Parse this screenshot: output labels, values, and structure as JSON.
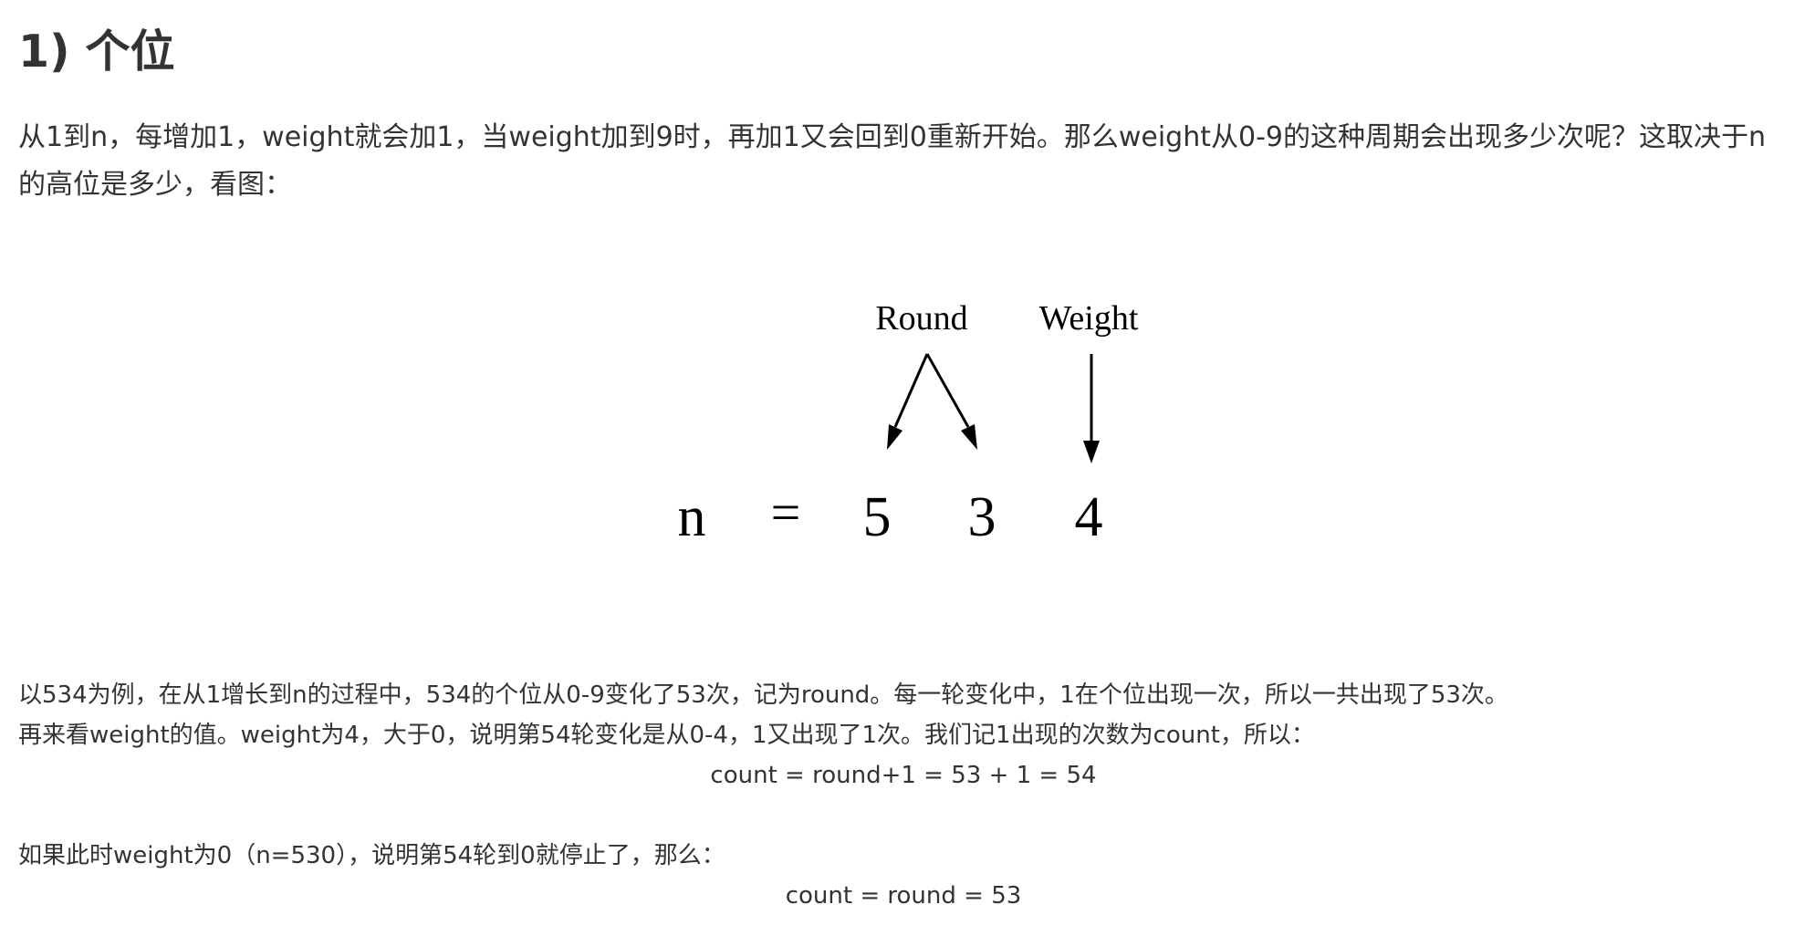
{
  "heading": "1) 个位",
  "intro_text": "从1到n，每增加1，weight就会加1，当weight加到9时，再加1又会回到0重新开始。那么weight从0-9的这种周期会出现多少次呢？这取决于n的高位是多少，看图：",
  "figure": {
    "round_label": "Round",
    "weight_label": "Weight",
    "n_label": "n",
    "equals_sign": "=",
    "digit_hundreds": "5",
    "digit_tens": "3",
    "digit_ones": "4",
    "highlight_color": "#e8141b"
  },
  "explanation": {
    "line1": "以534为例，在从1增长到n的过程中，534的个位从0-9变化了53次，记为round。每一轮变化中，1在个位出现一次，所以一共出现了53次。",
    "line2": "再来看weight的值。weight为4，大于0，说明第54轮变化是从0-4，1又出现了1次。我们记1出现的次数为count，所以：",
    "formula1": "count = round+1 = 53 + 1 = 54",
    "line3": "如果此时weight为0（n=530），说明第54轮到0就停止了，那么：",
    "formula2": "count = round = 53"
  }
}
